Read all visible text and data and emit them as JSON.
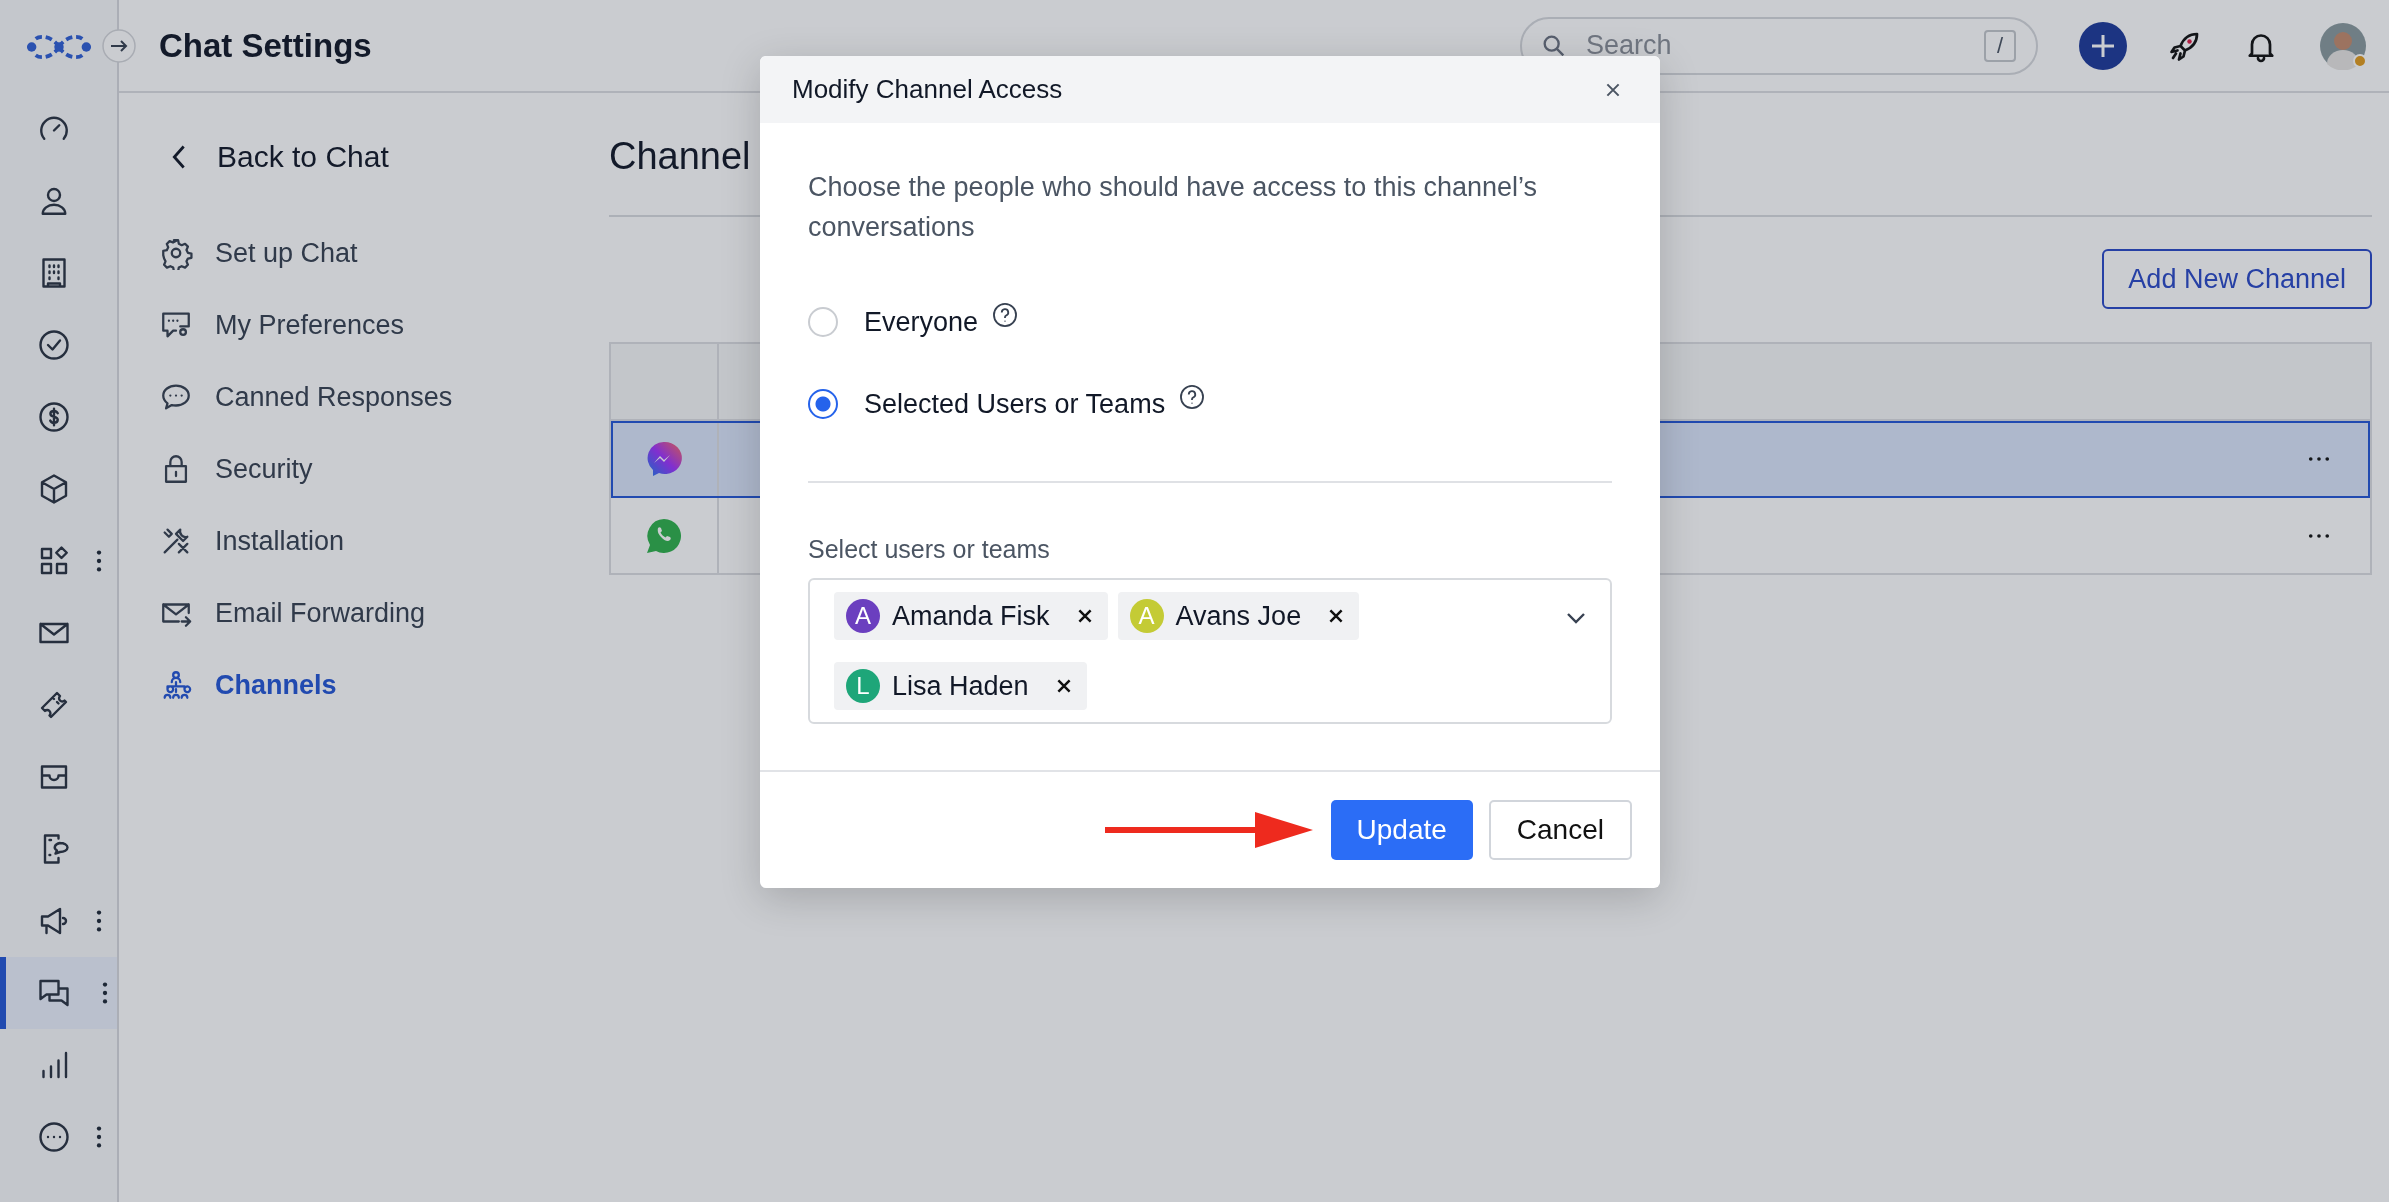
{
  "header": {
    "title": "Chat Settings",
    "search": {
      "placeholder": "Search",
      "shortcut": "/"
    }
  },
  "rail": [
    {
      "selected": false,
      "menu": false
    },
    {
      "selected": false,
      "menu": false
    },
    {
      "selected": false,
      "menu": false
    },
    {
      "selected": false,
      "menu": false
    },
    {
      "selected": false,
      "menu": false
    },
    {
      "selected": false,
      "menu": false
    },
    {
      "selected": false,
      "menu": true
    },
    {
      "selected": false,
      "menu": false
    },
    {
      "selected": false,
      "menu": false
    },
    {
      "selected": false,
      "menu": false
    },
    {
      "selected": false,
      "menu": false
    },
    {
      "selected": false,
      "menu": true
    },
    {
      "selected": true,
      "menu": true
    },
    {
      "selected": false,
      "menu": false
    },
    {
      "selected": false,
      "menu": true
    }
  ],
  "settings_nav": {
    "back": "Back to Chat",
    "items": [
      {
        "label": "Set up Chat",
        "selected": false
      },
      {
        "label": "My Preferences",
        "selected": false
      },
      {
        "label": "Canned Responses",
        "selected": false
      },
      {
        "label": "Security",
        "selected": false
      },
      {
        "label": "Installation",
        "selected": false
      },
      {
        "label": "Email Forwarding",
        "selected": false
      },
      {
        "label": "Channels",
        "selected": true
      }
    ]
  },
  "main": {
    "title": "Channel",
    "add_button": "Add New Channel",
    "table": {
      "rows": [
        {
          "kind": "messenger",
          "selected": true
        },
        {
          "kind": "whatsapp",
          "selected": false
        }
      ]
    }
  },
  "dialog": {
    "title": "Modify Channel Access",
    "description": "Choose the people who should have access to this channel’s conversations",
    "options": [
      {
        "label": "Everyone",
        "selected": false
      },
      {
        "label": "Selected Users or Teams",
        "selected": true
      }
    ],
    "field_label": "Select users or teams",
    "chips": [
      {
        "initial": "A",
        "name": "Amanda Fisk",
        "color": "#6b3fbf"
      },
      {
        "initial": "A",
        "name": "Avans Joe",
        "color": "#c4cb35"
      },
      {
        "initial": "L",
        "name": "Lisa Haden",
        "color": "#1ea679"
      }
    ],
    "buttons": [
      {
        "kind": "primary",
        "label": "Update"
      },
      {
        "kind": "secondary",
        "label": "Cancel"
      }
    ]
  }
}
